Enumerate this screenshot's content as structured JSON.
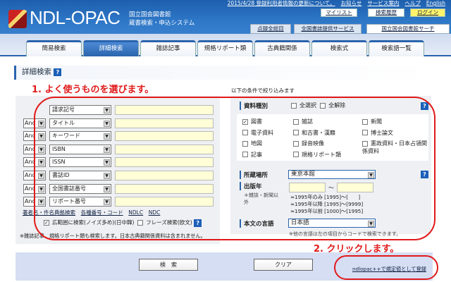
{
  "header": {
    "logo_text": "NDL-OPAC",
    "logo_sub1": "国立国会図書館",
    "logo_sub2": "蔵書検索・申込システム",
    "top_links": [
      "2015/4/28 登録利用者情報の更新について。",
      "お知らせ",
      "サービス案内",
      "ヘルプ",
      "English"
    ],
    "mylist": "マイリスト",
    "history": "検索履歴",
    "login": "ログイン",
    "catalog": "点録全総目",
    "biblio_service": "全国書誌提供サービス",
    "ndl_search": "国立国会図書館サーチ"
  },
  "tabs": [
    {
      "label": "簡易検索"
    },
    {
      "label": "詳細検索",
      "active": true
    },
    {
      "label": "雑誌記事"
    },
    {
      "label": "規格リポート類"
    },
    {
      "label": "古典籍関係"
    },
    {
      "label": "検索式"
    },
    {
      "label": "検索語一覧"
    }
  ],
  "page_title": "詳細検索",
  "annotation1": "1. よく使うものを選びます。",
  "annotation2": "2. クリックします。",
  "left": {
    "rows": [
      {
        "op": "",
        "field": "請求記号",
        "value": ""
      },
      {
        "op": "And",
        "field": "タイトル",
        "value": ""
      },
      {
        "op": "And",
        "field": "キーワード",
        "value": ""
      },
      {
        "op": "And",
        "field": "ISBN",
        "value": ""
      },
      {
        "op": "And",
        "field": "ISSN",
        "value": ""
      },
      {
        "op": "And",
        "field": "書誌ID",
        "value": ""
      },
      {
        "op": "And",
        "field": "全国書誌番号",
        "value": ""
      },
      {
        "op": "And",
        "field": "リポート番号",
        "value": ""
      }
    ],
    "links": [
      "著者名・件名典拠検索",
      "各種番号・コード",
      "NDLC",
      "NDC"
    ],
    "broad_search": "広範囲に検索(ノイズ多め)(日中韓)",
    "broad_checked": true,
    "phrase_search": "フレーズ検索(欧文)",
    "phrase_checked": false,
    "note": "※雑誌記事、規格リポート類も検索します。日本古典籍関係資料は含まれません。"
  },
  "right": {
    "intro": "以下の条件で絞り込みます",
    "type_label": "資料種別",
    "select_all": "全選択",
    "deselect_all": "全解除",
    "types": [
      {
        "label": "図書",
        "checked": true
      },
      {
        "label": "雑誌",
        "checked": false
      },
      {
        "label": "新聞",
        "checked": false
      },
      {
        "label": "電子資料",
        "checked": false
      },
      {
        "label": "和古書・漢籍",
        "checked": false
      },
      {
        "label": "博士論文",
        "checked": false
      },
      {
        "label": "地図",
        "checked": false
      },
      {
        "label": "録音映像",
        "checked": false
      },
      {
        "label": "憲政資料・日本占領関係資料",
        "checked": false
      },
      {
        "label": "記事",
        "checked": false
      },
      {
        "label": "規格リポート類",
        "checked": false
      }
    ],
    "location_label": "所蔵場所",
    "location_value": "東京本館",
    "year_label": "出版年",
    "year_note": "＊雑誌・新聞以外",
    "year_from": "",
    "year_to": "",
    "tilde": "〜",
    "year_examples": [
      "≈1995年のみ [1995]〜[　　]",
      "≈1995年以降 [1995]〜[9999]",
      "≈1995年以前 [1000]〜[1995]"
    ],
    "lang_label": "本文の言語",
    "lang_value": "日本語",
    "lang_note": "※他の言語は左の項目からコードで検索できます。"
  },
  "buttons": {
    "search": "検　索",
    "clear": "クリア",
    "register": "ndlopac++で規定値として登録"
  },
  "colors": {
    "accent": "#2a64ad",
    "annotation": "#e01a1a",
    "input_bg": "#fffed6"
  }
}
